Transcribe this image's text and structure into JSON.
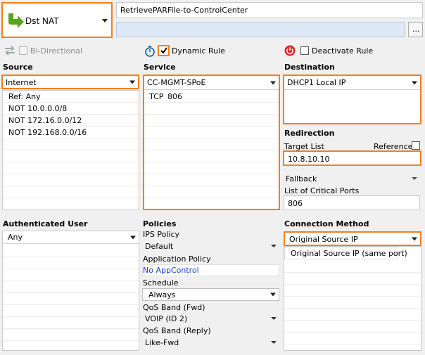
{
  "header": {
    "action_label": "Dst NAT",
    "rule_name": "RetrievePARFile-to-ControlCenter",
    "description_value": "",
    "more_button": "..."
  },
  "options": {
    "bidirectional": "Bi-Directional",
    "dynamic_rule": "Dynamic Rule",
    "deactivate_rule": "Deactivate Rule"
  },
  "source": {
    "heading": "Source",
    "selected": "Internet",
    "items": [
      "Ref: Any",
      "NOT 10.0.0.0/8",
      "NOT 172.16.0.0/12",
      "NOT 192.168.0.0/16"
    ]
  },
  "service": {
    "heading": "Service",
    "selected": "CC-MGMT-SPoE",
    "items": [
      {
        "proto": "TCP",
        "port": "806"
      }
    ]
  },
  "destination": {
    "heading": "Destination",
    "selected": "DHCP1 Local IP"
  },
  "redirection": {
    "heading": "Redirection",
    "target_list_label": "Target List",
    "reference_label": "Reference",
    "target_value": "10.8.10.10",
    "fallback": "Fallback",
    "critical_ports_label": "List of Critical Ports",
    "critical_ports_value": "806"
  },
  "auth_user": {
    "heading": "Authenticated User",
    "selected": "Any"
  },
  "policies": {
    "heading": "Policies",
    "ips_label": "IPS Policy",
    "ips_value": "Default",
    "app_label": "Application Policy",
    "app_value": "No AppControl",
    "schedule_label": "Schedule",
    "schedule_value": "Always",
    "qos_fwd_label": "QoS Band (Fwd)",
    "qos_fwd_value": "VOIP (ID 2)",
    "qos_reply_label": "QoS Band (Reply)",
    "qos_reply_value": "Like-Fwd"
  },
  "connection": {
    "heading": "Connection Method",
    "selected": "Original Source IP",
    "items": [
      "Original Source IP (same port)"
    ]
  },
  "colors": {
    "accent": "#f27f1e",
    "green_arrow": "#5ba31f",
    "link_blue": "#1a3fcf",
    "power_red": "#d6282a"
  }
}
